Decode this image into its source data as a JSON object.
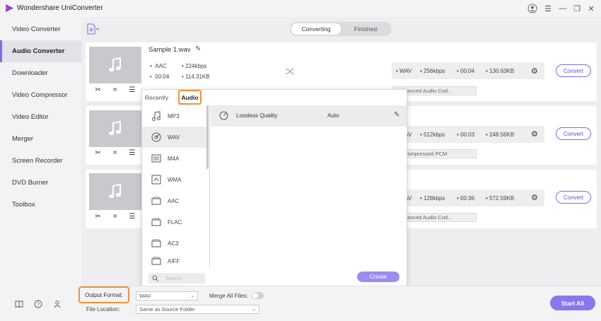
{
  "window": {
    "title": "Wondershare UniConverter"
  },
  "sidebar": {
    "items": [
      {
        "label": "Video Converter"
      },
      {
        "label": "Audio Converter"
      },
      {
        "label": "Downloader"
      },
      {
        "label": "Video Compressor"
      },
      {
        "label": "Video Editor"
      },
      {
        "label": "Merger"
      },
      {
        "label": "Screen Recorder"
      },
      {
        "label": "DVD Burner"
      },
      {
        "label": "Toolbox"
      }
    ],
    "active_index": 1
  },
  "tabs": {
    "converting": "Converting",
    "finished": "Finished"
  },
  "files": [
    {
      "name": "Sample 1.wav",
      "codec": "AAC",
      "bitrate": "224kbps",
      "duration": "00:04",
      "size": "114.31KB",
      "out_format": "WAV",
      "out_bitrate": "256kbps",
      "out_duration": "00:04",
      "out_size": "130.63KB",
      "out_codec": "Advanced Audio Cod...",
      "convert_label": "Convert"
    },
    {
      "out_format": "WAV",
      "out_bitrate": "512kbps",
      "out_duration": "00:03",
      "out_size": "248.56KB",
      "out_codec": "Uncompressed PCM",
      "convert_label": "Convert"
    },
    {
      "out_format": "WAV",
      "out_bitrate": "128kbps",
      "out_duration": "00:36",
      "out_size": "572.59KB",
      "out_codec": "Advanced Audio Cod...",
      "convert_label": "Convert"
    }
  ],
  "format_panel": {
    "tabs": {
      "recently": "Recently",
      "audio": "Audio"
    },
    "formats": [
      "MP3",
      "WAV",
      "M4A",
      "WMA",
      "AAC",
      "FLAC",
      "AC3",
      "AIFF"
    ],
    "selected_format": "WAV",
    "quality_rows": [
      {
        "label": "Lossless Quality",
        "value": "Auto"
      }
    ],
    "search_placeholder": "Search",
    "create_label": "Create"
  },
  "footer": {
    "output_format_label": "Output Format:",
    "output_format_value": "WAV",
    "merge_label": "Merge All Files:",
    "merge_enabled": false,
    "file_location_label": "File Location:",
    "file_location_value": "Same as Source Folder",
    "start_all_label": "Start All"
  },
  "colors": {
    "accent": "#7b6ee6",
    "highlight": "#f0923a"
  }
}
